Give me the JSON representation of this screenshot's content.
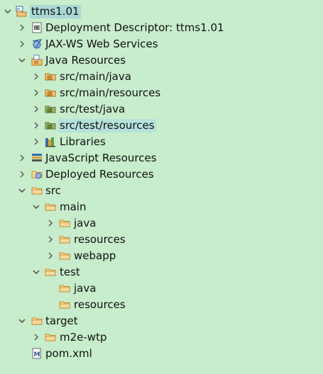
{
  "tree": {
    "project": "ttms1.01",
    "deployment_descriptor": "Deployment Descriptor: ttms1.01",
    "jaxws": "JAX-WS Web Services",
    "java_resources": "Java Resources",
    "src_main_java": "src/main/java",
    "src_main_resources": "src/main/resources",
    "src_test_java": "src/test/java",
    "src_test_resources": "src/test/resources",
    "libraries": "Libraries",
    "javascript_resources": "JavaScript Resources",
    "deployed_resources": "Deployed Resources",
    "src": "src",
    "main": "main",
    "main_java": "java",
    "main_resources": "resources",
    "webapp": "webapp",
    "test": "test",
    "test_java": "java",
    "test_resources": "resources",
    "target": "target",
    "m2e_wtp": "m2e-wtp",
    "pom": "pom.xml"
  }
}
